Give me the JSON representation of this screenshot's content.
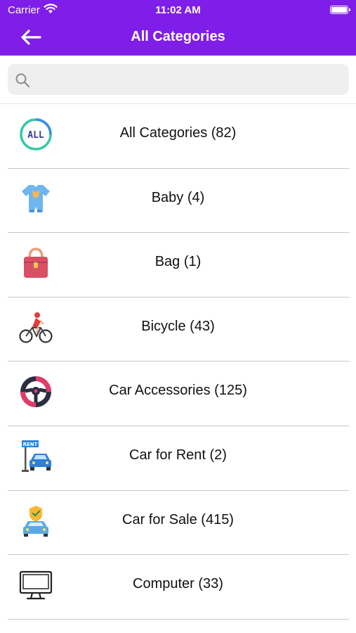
{
  "status_bar": {
    "carrier": "Carrier",
    "time": "11:02 AM"
  },
  "nav": {
    "title": "All Categories"
  },
  "search": {
    "placeholder": ""
  },
  "categories": [
    {
      "label": "All Categories (82)",
      "icon": "all-badge-icon"
    },
    {
      "label": "Baby (4)",
      "icon": "baby-onesie-icon"
    },
    {
      "label": "Bag (1)",
      "icon": "handbag-icon"
    },
    {
      "label": "Bicycle (43)",
      "icon": "cyclist-icon"
    },
    {
      "label": "Car Accessories (125)",
      "icon": "steering-wheel-icon"
    },
    {
      "label": "Car for Rent (2)",
      "icon": "rent-car-icon"
    },
    {
      "label": "Car for Sale (415)",
      "icon": "car-shield-icon"
    },
    {
      "label": "Computer (33)",
      "icon": "computer-monitor-icon"
    }
  ],
  "colors": {
    "header": "#7f1ee8",
    "background": "#ffffff",
    "search_bg": "#efefef",
    "separator": "#c8c8c8"
  }
}
